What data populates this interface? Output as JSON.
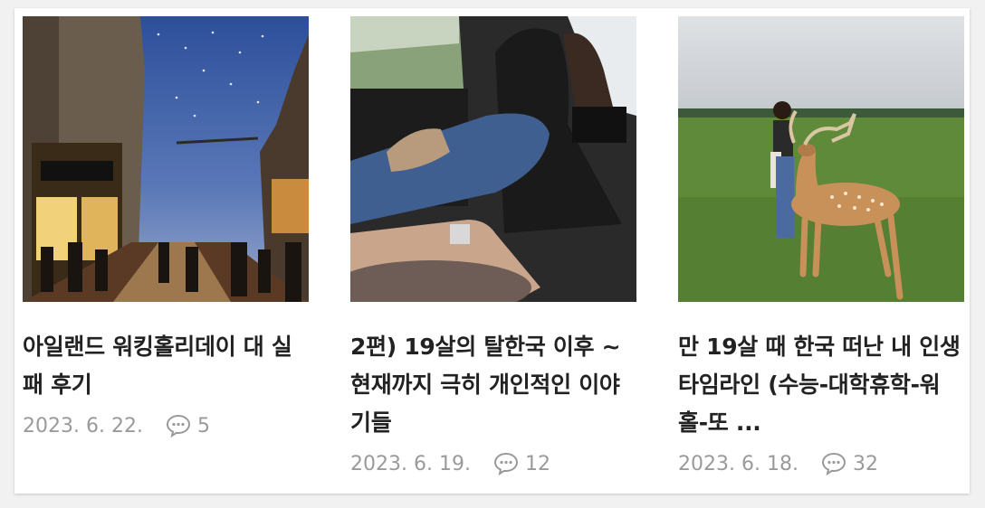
{
  "posts": [
    {
      "title": "아일랜드 워킹홀리데이 대 실패 후기",
      "date": "2023. 6. 22.",
      "comments": "5",
      "thumbnail": "street-at-dusk-photo"
    },
    {
      "title": "2편) 19살의 탈한국 이후 ~ 현재까지 극히 개인적인 이야기들",
      "date": "2023. 6. 19.",
      "comments": "12",
      "thumbnail": "car-interior-photo"
    },
    {
      "title": "만 19살 때 한국 떠난 내 인생 타임라인 (수능-대학휴학-워홀-또 ...",
      "date": "2023. 6. 18.",
      "comments": "32",
      "thumbnail": "deer-in-park-photo"
    }
  ],
  "icons": {
    "comment": "speech-bubble-icon"
  },
  "colors": {
    "title": "#222222",
    "meta": "#9a9a9a",
    "background": "#ffffff"
  }
}
